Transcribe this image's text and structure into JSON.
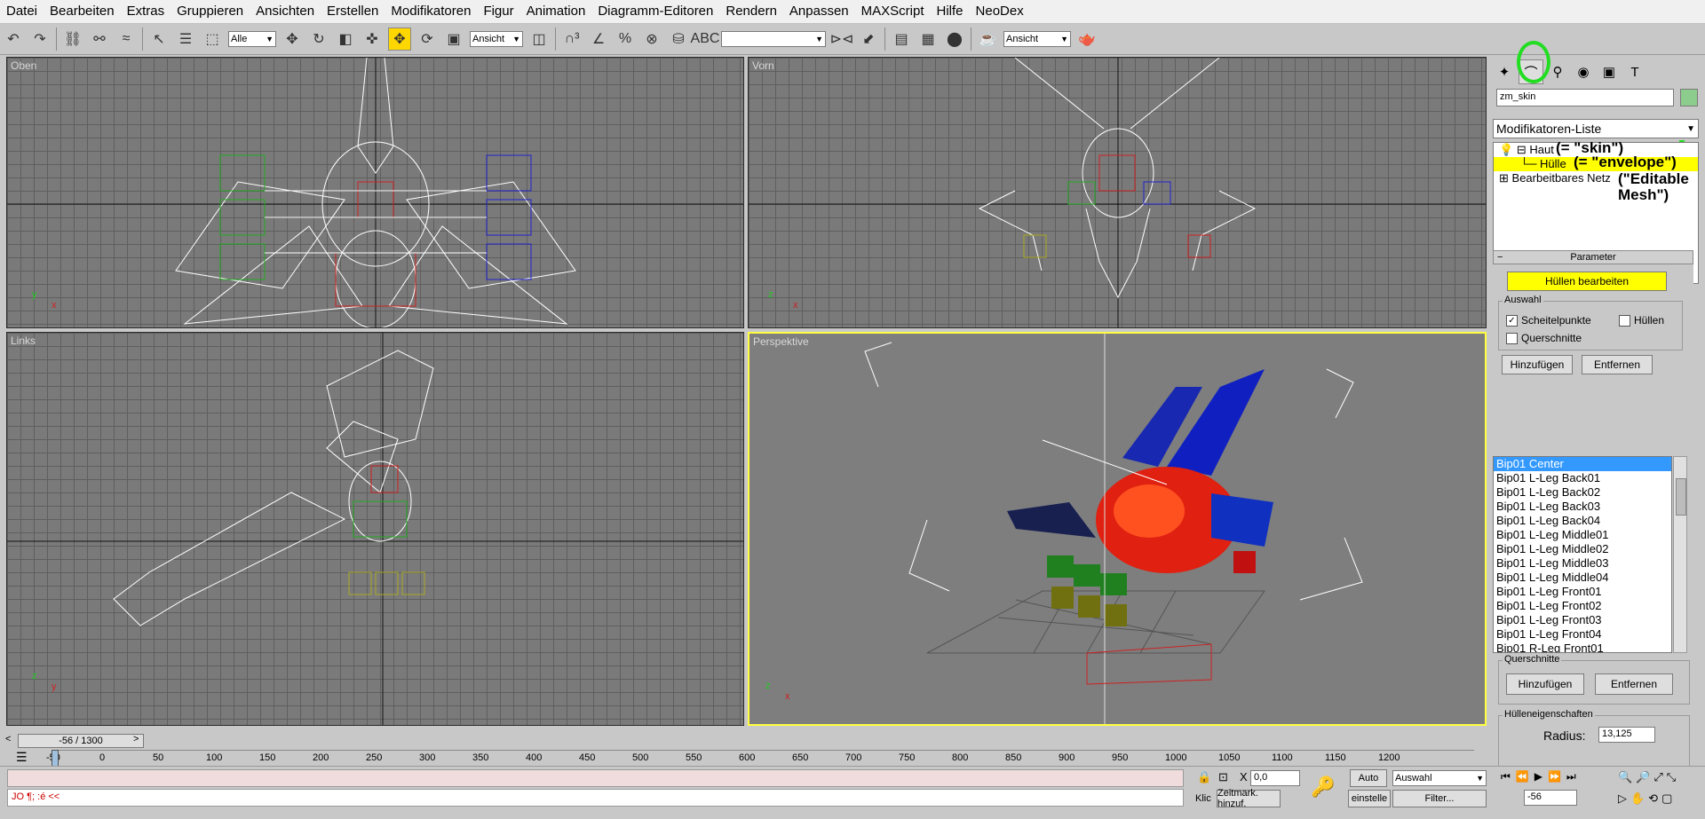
{
  "menu": [
    "Datei",
    "Bearbeiten",
    "Extras",
    "Gruppieren",
    "Ansichten",
    "Erstellen",
    "Modifikatoren",
    "Figur",
    "Animation",
    "Diagramm-Editoren",
    "Rendern",
    "Anpassen",
    "MAXScript",
    "Hilfe",
    "NeoDex"
  ],
  "toolbar": {
    "selection_filter": "Alle",
    "ref_coord": "Ansicht",
    "named_sel": "",
    "render_type": "Ansicht"
  },
  "viewports": {
    "top": "Oben",
    "front": "Vorn",
    "left": "Links",
    "persp": "Perspektive"
  },
  "panel": {
    "object_name": "zm_skin",
    "modifier_list": "Modifikatoren-Liste",
    "stack": [
      {
        "label": "Haut",
        "note": "(= \"skin\")"
      },
      {
        "label": "Hülle",
        "note": "(= \"envelope\")"
      },
      {
        "label": "Bearbeitbares Netz",
        "note": "(\"Editable Mesh\")"
      }
    ],
    "rollout_title": "Parameter",
    "edit_envelopes": "Hüllen bearbeiten",
    "auswahl_title": "Auswahl",
    "chk_vertices": "Scheitelpunkte",
    "chk_envelopes": "Hüllen",
    "chk_cross": "Querschnitte",
    "add": "Hinzufügen",
    "remove": "Entfernen",
    "bones": [
      "Bip01 Center",
      "Bip01 L-Leg Back01",
      "Bip01 L-Leg Back02",
      "Bip01 L-Leg Back03",
      "Bip01 L-Leg Back04",
      "Bip01 L-Leg Middle01",
      "Bip01 L-Leg Middle02",
      "Bip01 L-Leg Middle03",
      "Bip01 L-Leg Middle04",
      "Bip01 L-Leg Front01",
      "Bip01 L-Leg Front02",
      "Bip01 L-Leg Front03",
      "Bip01 L-Leg Front04",
      "Bip01 R-Leg Front01"
    ],
    "cross_title": "Querschnitte",
    "cross_add": "Hinzufügen",
    "cross_remove": "Entfernen",
    "env_props_title": "Hülleneigenschaften",
    "radius_label": "Radius:",
    "radius_value": "13,125"
  },
  "timeline": {
    "slider": "-56 / 1300",
    "ticks": [
      "-50",
      "0",
      "50",
      "100",
      "150",
      "200",
      "250",
      "300",
      "350",
      "400",
      "450",
      "500",
      "550",
      "600",
      "650",
      "700",
      "750",
      "800",
      "850",
      "900",
      "950",
      "1000",
      "1050",
      "1100",
      "1150",
      "1200"
    ]
  },
  "status": {
    "script_text": "JO ¶; :é <<",
    "x_label": "X",
    "x_value": "0,0",
    "auto": "Auto",
    "auswahl": "Auswahl",
    "frame": "-56",
    "klic": "Klic",
    "zeitmark": "Zeitmark. hinzuf.",
    "einstell": "einstelle",
    "filter": "Filter..."
  },
  "colors": {
    "selection_yellow": "#ffff00",
    "list_blue": "#3399ff",
    "annotation_green": "#22dd22"
  }
}
